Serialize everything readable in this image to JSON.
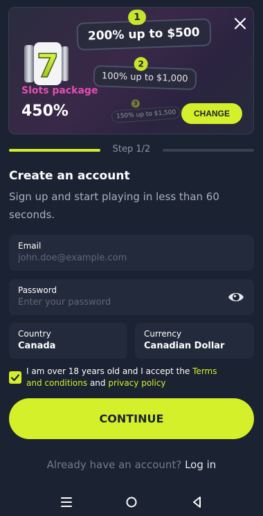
{
  "promo": {
    "tiers": [
      {
        "number": "1",
        "text": "200% up to $500"
      },
      {
        "number": "2",
        "text": "100% up to $1,000"
      },
      {
        "number": "3",
        "text": "150% up to $1,500"
      }
    ],
    "package_label": "Slots package",
    "package_percent": "450%",
    "change_label": "CHANGE",
    "slot_digit": "7"
  },
  "steps": {
    "label": "Step 1/2",
    "current": 1,
    "total": 2
  },
  "form": {
    "title": "Create an account",
    "subtitle": "Sign up and start playing in less than 60 seconds.",
    "email": {
      "label": "Email",
      "placeholder": "john.doe@example.com"
    },
    "password": {
      "label": "Password",
      "placeholder": "Enter your password"
    },
    "country": {
      "label": "Country",
      "value": "Canada"
    },
    "currency": {
      "label": "Currency",
      "value": "Canadian Dollar"
    },
    "terms": {
      "prefix": "I am over 18 years old and I accept the ",
      "terms_link": "Terms and conditions",
      "middle": " and ",
      "privacy_link": "privacy policy",
      "checked": true
    },
    "continue_label": "CONTINUE",
    "login_prompt": "Already have an account?",
    "login_link": "Log in"
  },
  "icons": {
    "close": "close-icon",
    "eye": "eye-icon",
    "check": "check-icon",
    "nav_menu": "menu-icon",
    "nav_home": "home-icon",
    "nav_back": "back-icon"
  },
  "colors": {
    "background": "#1b2232",
    "accent": "#d4f02a",
    "package_label": "#e54fb2",
    "field_bg": "#222a3b"
  }
}
